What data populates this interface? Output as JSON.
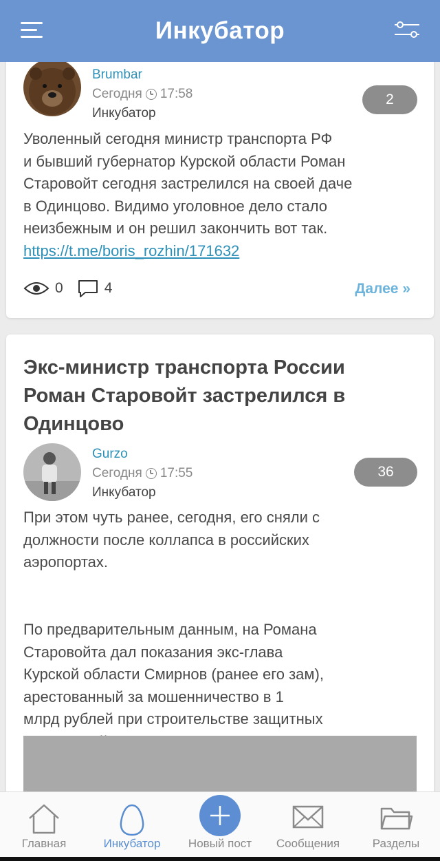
{
  "header": {
    "title": "Инкубатор",
    "menu_icon": "hamburger-icon",
    "filter_icon": "sliders-icon"
  },
  "posts": [
    {
      "author": "Brumbar",
      "date": "Сегодня",
      "time": "17:58",
      "section": "Инкубатор",
      "rating": "2",
      "lines": [
        "Уволенный сегодня министр транспорта РФ",
        "и бывший губернатор Курской области Роман",
        "Старовойт сегодня застрелился на своей даче",
        "в Одинцово. Видимо уголовное дело стало",
        "неизбежным и он решил закончить вот так."
      ],
      "link": "https://t.me/boris_rozhin/171632",
      "views": "0",
      "comments": "4",
      "more_label": "Далее »"
    },
    {
      "title": "Экс-министр транспорта России Роман Старовойт застрелился в Одинцово",
      "author": "Gurzo",
      "date": "Сегодня",
      "time": "17:55",
      "section": "Инкубатор",
      "rating": "36",
      "para1": [
        "При этом чуть ранее, сегодня, его сняли с",
        "должности после коллапса в российских",
        "аэропортах."
      ],
      "para2": [
        "По предварительным данным, на Романа",
        "Старовойта дал показания экс-глава",
        "Курской области Смирнов (ранее его зам),",
        "арестованный за мошенничество в 1",
        "млрд рублей при строительстве защитных",
        "сооружений в регионе."
      ]
    }
  ],
  "nav": [
    {
      "label": "Главная",
      "icon": "home-icon"
    },
    {
      "label": "Инкубатор",
      "icon": "egg-icon"
    },
    {
      "label": "Новый пост",
      "icon": "plus-icon"
    },
    {
      "label": "Сообщения",
      "icon": "envelope-icon"
    },
    {
      "label": "Разделы",
      "icon": "folder-icon"
    }
  ],
  "colors": {
    "header": "#6a95d0",
    "accent": "#5d8ed3",
    "link": "#2c90b8",
    "rating_bg": "#8d8d8d"
  }
}
